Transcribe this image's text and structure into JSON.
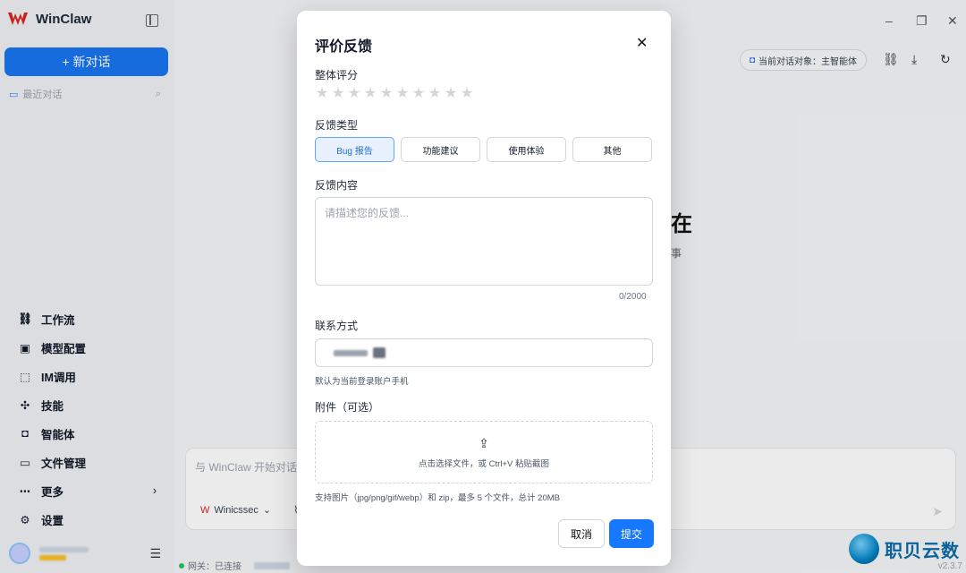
{
  "app": {
    "name": "WinClaw",
    "new_chat": "+ 新对话",
    "recent": "最近对话"
  },
  "nav": [
    {
      "label": "工作流",
      "icon": "workflow-icon"
    },
    {
      "label": "模型配置",
      "icon": "chip-icon"
    },
    {
      "label": "IM调用",
      "icon": "scan-icon"
    },
    {
      "label": "技能",
      "icon": "puzzle-icon"
    },
    {
      "label": "智能体",
      "icon": "robot-icon"
    },
    {
      "label": "文件管理",
      "icon": "folder-icon"
    },
    {
      "label": "更多",
      "icon": "more-icon"
    },
    {
      "label": "设置",
      "icon": "gear-icon"
    }
  ],
  "main": {
    "target": "当前对话对象：主智能体",
    "hero_char": "在",
    "hero_sub": "事",
    "composer_placeholder": "与 WinClaw 开始对话",
    "agent": "Winicssec",
    "status_prefix": "网关：已连接",
    "version": "v2.3.7"
  },
  "watermark": "职贝云数",
  "modal": {
    "title": "评价反馈",
    "rating_label": "整体评分",
    "rating_value": 0,
    "rating_max": 10,
    "type_label": "反馈类型",
    "types": [
      "Bug 报告",
      "功能建议",
      "使用体验",
      "其他"
    ],
    "content_label": "反馈内容",
    "content_placeholder": "请描述您的反馈...",
    "counter": "0/2000",
    "contact_label": "联系方式",
    "contact_hint": "默认为当前登录账户手机",
    "attach_label": "附件（可选）",
    "upload_text": "点击选择文件，或 Ctrl+V 粘贴截图",
    "attach_hint": "支持图片（jpg/png/gif/webp）和 zip，最多 5 个文件，总计 20MB",
    "cancel": "取消",
    "submit": "提交"
  }
}
